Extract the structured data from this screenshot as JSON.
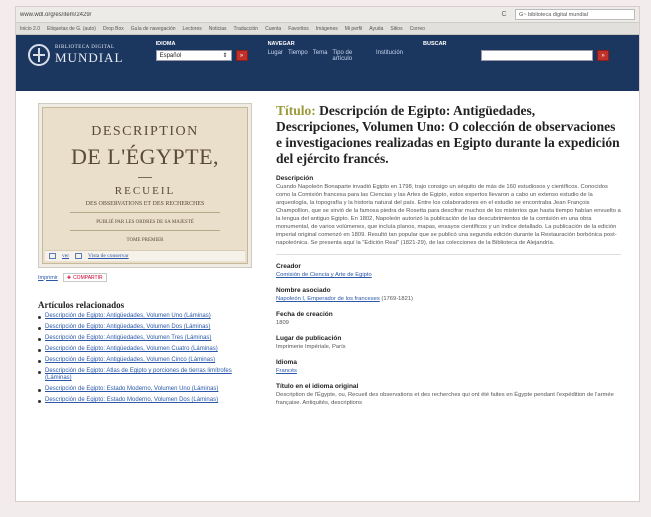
{
  "browser": {
    "url": "www.wdl.org/es/item/2429/",
    "reload_glyph": "C",
    "search_text": "G~ biblioteca digital mundial",
    "bookmarks": [
      "Inicio 2.0",
      "Etiquetas de G. (auto)",
      "Drop Box",
      "Guía de navegación",
      "Lectores",
      "Noticias",
      "Traducción",
      "Cuenta",
      "Favoritos",
      "Imágenes",
      "Mi perfil",
      "Ayuda",
      "Sitios",
      "Correo"
    ]
  },
  "site": {
    "logo_small": "BIBLIOTECA DIGITAL",
    "logo_big": "MUNDIAL",
    "language_label": "IDIOMA",
    "language_value": "Español",
    "navigate_label": "NAVEGAR",
    "nav_links": [
      "Lugar",
      "Tiempo",
      "Tema",
      "Tipo de artículo",
      "Institución"
    ],
    "search_label": "BUSCAR",
    "go_glyph": "»"
  },
  "cover": {
    "line1": "DESCRIPTION",
    "line2": "DE L'ÉGYPTE,",
    "line3": "RECUEIL",
    "line4": "DES OBSERVATIONS ET DES RECHERCHES",
    "line5": "PUBLIÉ PAR LES ORDRES DE SA MAJESTÉ",
    "line6": "TOME PREMIER"
  },
  "viewer": {
    "zoom_link": "ver",
    "tile_link": "Vista de conservar"
  },
  "share": {
    "print_link": "Imprimir",
    "share_label": "COMPARTIR"
  },
  "related": {
    "title": "Artículos relacionados",
    "items": [
      "Descripción de Egipto: Antigüedades, Volumen Uno (Láminas)",
      "Descripción de Egipto: Antigüedades, Volumen Dos (Láminas)",
      "Descripción de Egipto: Antigüedades, Volumen Tres (Láminas)",
      "Descripción de Egipto: Antigüedades, Volumen Cuatro (Láminas)",
      "Descripción de Egipto: Antigüedades, Volumen Cinco (Láminas)",
      "Descripción de Egipto: Atlas de Egipto y porciones de tierras limítrofes (Láminas)",
      "Descripción de Egipto: Estado Moderno, Volumen Uno (Láminas)",
      "Descripción de Egipto: Estado Moderno, Volumen Dos (Láminas)"
    ]
  },
  "item": {
    "title_label": "Título:",
    "title": "Descripción de Egipto: Antigüedades, Descripciones, Volumen Uno: O colección de observaciones e investigaciones realizadas en Egipto durante la expedición del ejército francés.",
    "description_label": "Descripción",
    "description": "Cuando Napoleón Bonaparte invadió Egipto en 1798, trajo consigo un séquito de más de 160 estudiosos y científicos. Conocidos como la Comisión francesa para las Ciencias y las Artes de Egipto, estos expertos llevaron a cabo un extenso estudio de la arqueología, la topografía y la historia natural del país. Entre los colaboradores en el estudio se encontraba Jean François Champollion, que se sirvió de la famosa piedra de Rosetta para descifrar muchos de los misterios que hasta tiempo habían envuelto a la lengua del antiguo Egipto. En 1802, Napoleón autorizó la publicación de las descubrimientos de la comisión en una obra monumental, de varios volúmenes, que incluía planos, mapas, ensayos científicos y un índice detallado. La publicación de la edición imperial original comenzó en 1809. Resultó tan popular que se publicó una segunda edición durante la Restauración borbónica post-napoleónica. Se presenta aquí la \"Edición Real\" (1821-29), de las colecciones de la Biblioteca de Alejandría.",
    "creator_label": "Creador",
    "creator": "Comisión de Ciencia y Arte de Egipto",
    "associated_label": "Nombre asociado",
    "associated_link": "Napoleón I, Emperador de los franceses",
    "associated_dates": "(1769-1821)",
    "created_label": "Fecha de creación",
    "created": "1809",
    "place_label": "Lugar de publicación",
    "place": "Imprimerie Impériale, París",
    "language_label": "Idioma",
    "language": "Francés",
    "original_title_label": "Título en el idioma original",
    "original_title": "Description de l'Égypte, ou, Recueil des observations et des recherches qui ont été faites en Égypte pendant l'expédition de l'armée française. Antiquités, descriptions"
  }
}
